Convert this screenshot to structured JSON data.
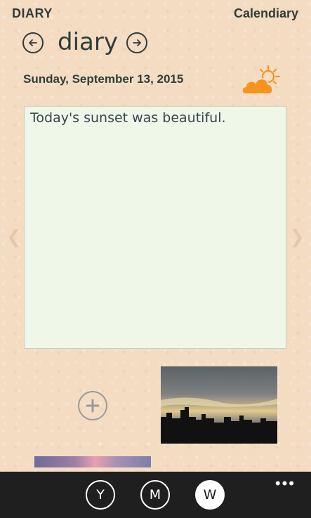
{
  "header": {
    "app_name": "DIARY",
    "right_link": "Calendiary"
  },
  "nav": {
    "title": "diary",
    "prev_icon": "arrow-left-icon",
    "next_icon": "arrow-right-icon"
  },
  "date": "Sunday, September 13, 2015",
  "weather": {
    "icon": "partly-sunny-icon",
    "sun_color": "#f7941d",
    "cloud_color": "#f7941d"
  },
  "entry": {
    "text": "Today's sunset was beautiful."
  },
  "side_nav": {
    "left": "❮",
    "right": "❯"
  },
  "attachments": {
    "add_icon": "plus-icon"
  },
  "app_bar": {
    "buttons": [
      {
        "label": "Y",
        "selected": false
      },
      {
        "label": "M",
        "selected": false
      },
      {
        "label": "W",
        "selected": true
      }
    ],
    "more": "•••"
  },
  "colors": {
    "background": "#f4dcc3",
    "text": "#2f3d3a",
    "entry_bg": "#eff7e9",
    "app_bar": "#1f1f1f"
  }
}
